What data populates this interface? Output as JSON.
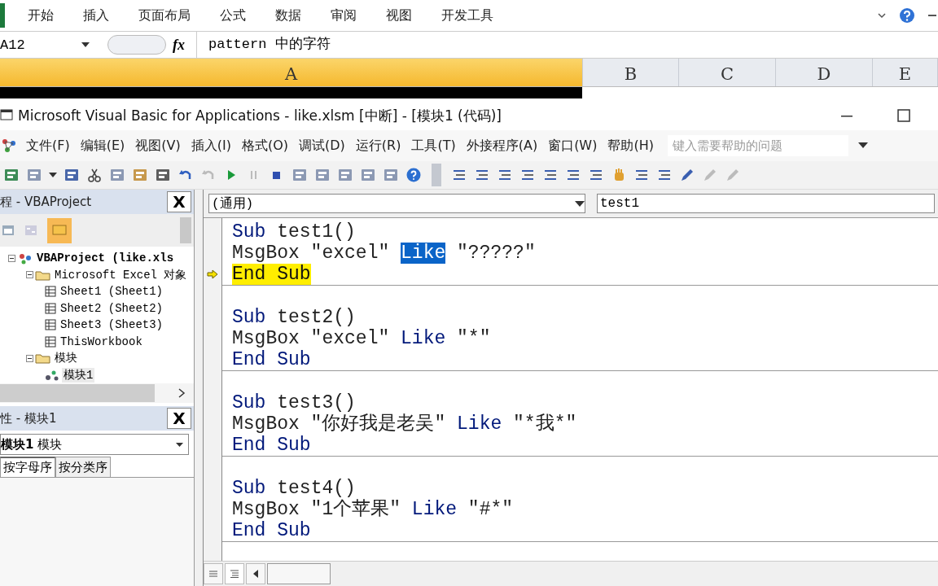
{
  "excel": {
    "ribbon_tabs": [
      {
        "label": "开始",
        "selected": false
      },
      {
        "label": "插入",
        "selected": false
      },
      {
        "label": "页面布局",
        "selected": false
      },
      {
        "label": "公式",
        "selected": false
      },
      {
        "label": "数据",
        "selected": false
      },
      {
        "label": "审阅",
        "selected": false
      },
      {
        "label": "视图",
        "selected": false
      },
      {
        "label": "开发工具",
        "selected": false
      }
    ],
    "name_box": "A12",
    "function_label": "fx",
    "formula": "pattern 中的字符",
    "columns": [
      {
        "label": "A",
        "selected": true
      },
      {
        "label": "B",
        "selected": false
      },
      {
        "label": "C",
        "selected": false
      },
      {
        "label": "D",
        "selected": false
      },
      {
        "label": "E",
        "selected": false
      }
    ]
  },
  "vbe": {
    "title": "Microsoft Visual Basic for Applications - like.xlsm [中断] - [模块1 (代码)]",
    "menu": [
      "文件(F)",
      "编辑(E)",
      "视图(V)",
      "插入(I)",
      "格式(O)",
      "调试(D)",
      "运行(R)",
      "工具(T)",
      "外接程序(A)",
      "窗口(W)",
      "帮助(H)"
    ],
    "help_search": {
      "placeholder": "键入需要帮助的问题"
    },
    "project_panel": {
      "title": "程 - VBAProject",
      "close": "X",
      "tree": [
        {
          "label": "VBAProject (like.xls",
          "expanded": true,
          "selected": false,
          "children": [
            {
              "label": "Microsoft Excel 对象",
              "expanded": true,
              "selected": false,
              "children": [
                {
                  "label": "Sheet1 (Sheet1)",
                  "selected": false
                },
                {
                  "label": "Sheet2 (Sheet2)",
                  "selected": false
                },
                {
                  "label": "Sheet3 (Sheet3)",
                  "selected": false
                },
                {
                  "label": "ThisWorkbook",
                  "selected": false
                }
              ]
            },
            {
              "label": "模块",
              "expanded": true,
              "selected": false,
              "children": [
                {
                  "label": "模块1",
                  "selected": true
                }
              ]
            }
          ]
        }
      ]
    },
    "properties_panel": {
      "title": "性 - 模块1",
      "close": "X",
      "object": "**模块1** 模块",
      "tabs": [
        {
          "label": "按字母序",
          "selected": true
        },
        {
          "label": "按分类序",
          "selected": false
        }
      ]
    },
    "code": {
      "object_dropdown": "(通用)",
      "procedure_dropdown": "test1",
      "procedures": [
        {
          "lines": [
            {
              "current": false,
              "segments": [
                {
                  "kind": "keyword",
                  "text": "Sub",
                  "selected": false
                },
                {
                  "kind": "plain",
                  "text": " test1()",
                  "selected": false
                }
              ]
            },
            {
              "current": false,
              "segments": [
                {
                  "kind": "plain",
                  "text": "MsgBox \"excel\" ",
                  "selected": false
                },
                {
                  "kind": "keyword",
                  "text": "Like",
                  "selected": true
                },
                {
                  "kind": "plain",
                  "text": " \"?????\"",
                  "selected": false
                }
              ]
            },
            {
              "current": true,
              "segments": [
                {
                  "kind": "keyword",
                  "text": "End Sub",
                  "selected": false
                }
              ]
            }
          ]
        },
        {
          "lines": [
            {
              "current": false,
              "segments": [
                {
                  "kind": "keyword",
                  "text": "Sub",
                  "selected": false
                },
                {
                  "kind": "plain",
                  "text": " test2()",
                  "selected": false
                }
              ]
            },
            {
              "current": false,
              "segments": [
                {
                  "kind": "plain",
                  "text": "MsgBox \"excel\" ",
                  "selected": false
                },
                {
                  "kind": "keyword",
                  "text": "Like",
                  "selected": false
                },
                {
                  "kind": "plain",
                  "text": " \"*\"",
                  "selected": false
                }
              ]
            },
            {
              "current": false,
              "segments": [
                {
                  "kind": "keyword",
                  "text": "End Sub",
                  "selected": false
                }
              ]
            }
          ]
        },
        {
          "lines": [
            {
              "current": false,
              "segments": [
                {
                  "kind": "keyword",
                  "text": "Sub",
                  "selected": false
                },
                {
                  "kind": "plain",
                  "text": " test3()",
                  "selected": false
                }
              ]
            },
            {
              "current": false,
              "segments": [
                {
                  "kind": "plain",
                  "text": "MsgBox \"你好我是老吴\" ",
                  "selected": false
                },
                {
                  "kind": "keyword",
                  "text": "Like",
                  "selected": false
                },
                {
                  "kind": "plain",
                  "text": " \"*我*\"",
                  "selected": false
                }
              ]
            },
            {
              "current": false,
              "segments": [
                {
                  "kind": "keyword",
                  "text": "End Sub",
                  "selected": false
                }
              ]
            }
          ]
        },
        {
          "lines": [
            {
              "current": false,
              "segments": [
                {
                  "kind": "keyword",
                  "text": "Sub",
                  "selected": false
                },
                {
                  "kind": "plain",
                  "text": " test4()",
                  "selected": false
                }
              ]
            },
            {
              "current": false,
              "segments": [
                {
                  "kind": "plain",
                  "text": "MsgBox \"1个苹果\" ",
                  "selected": false
                },
                {
                  "kind": "keyword",
                  "text": "Like",
                  "selected": false
                },
                {
                  "kind": "plain",
                  "text": " \"#*\"",
                  "selected": false
                }
              ]
            },
            {
              "current": false,
              "segments": [
                {
                  "kind": "keyword",
                  "text": "End Sub",
                  "selected": false
                }
              ]
            }
          ]
        }
      ]
    }
  }
}
